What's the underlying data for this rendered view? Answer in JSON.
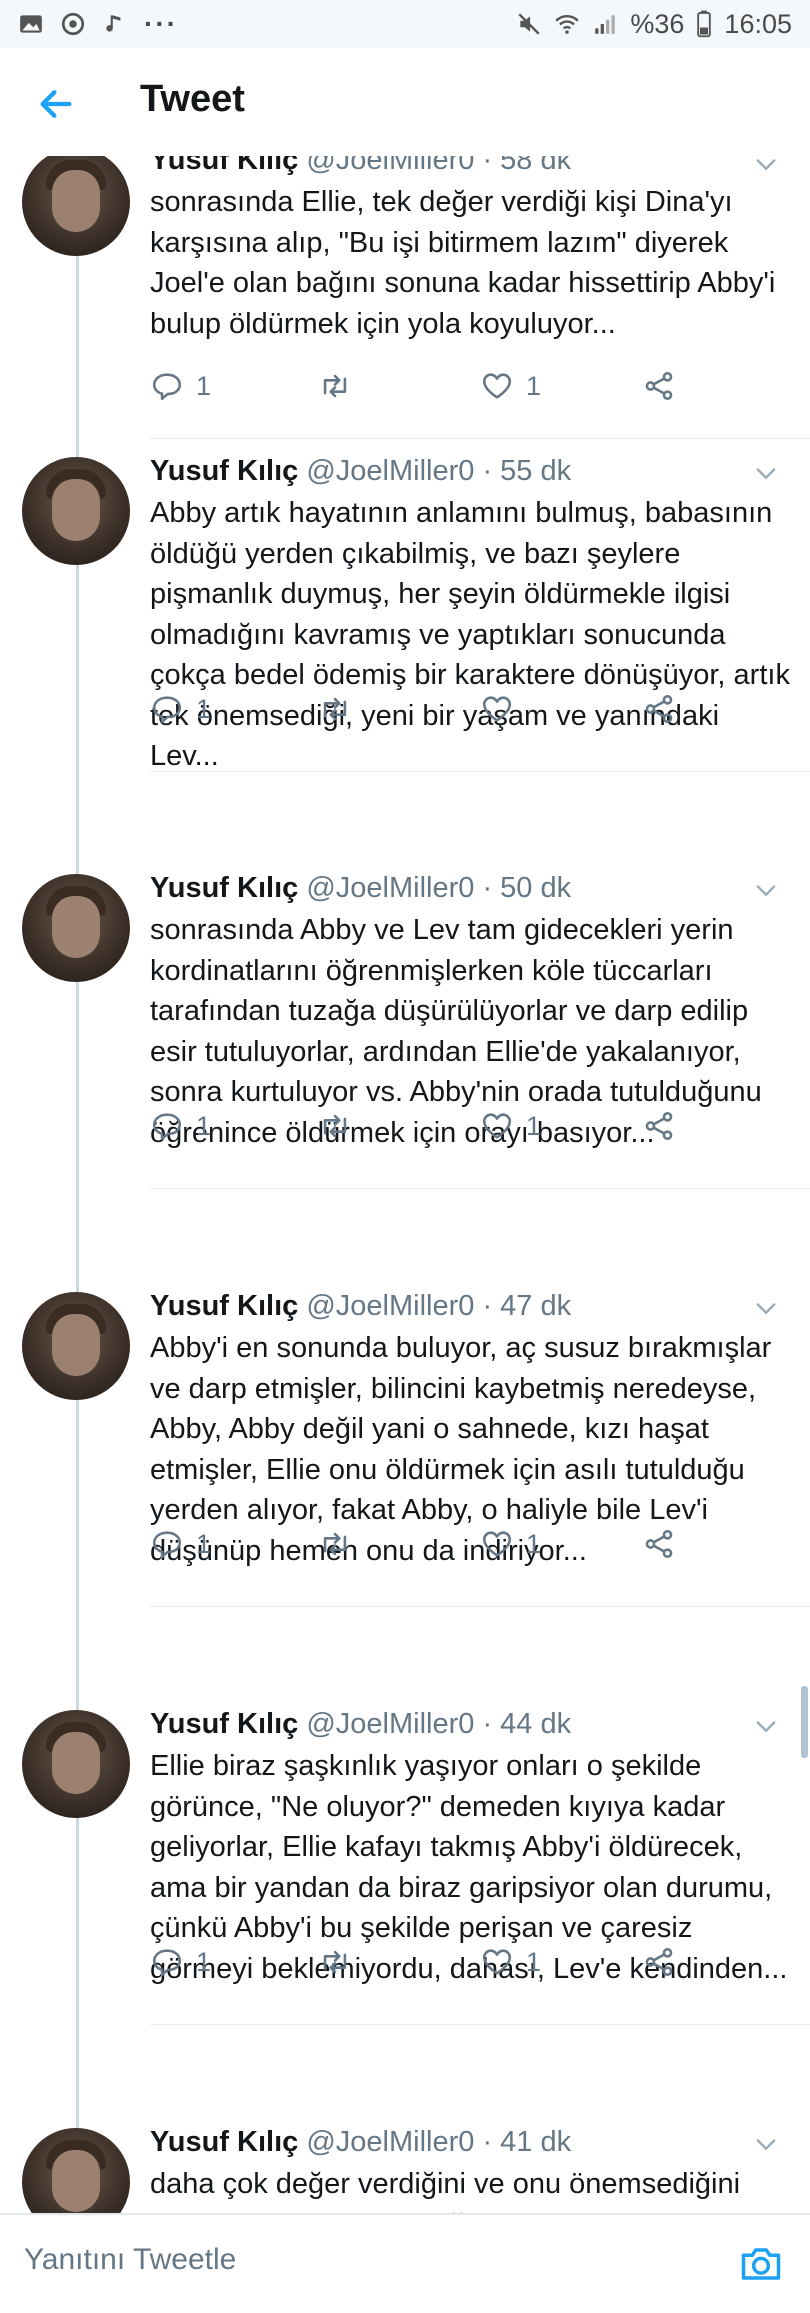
{
  "status_bar": {
    "battery": "%36",
    "time": "16:05",
    "dots": "···"
  },
  "header": {
    "title": "Tweet"
  },
  "colors": {
    "accent": "#1da1f2",
    "text": "#14171a",
    "secondary": "#657786",
    "divider": "#e6ecf0"
  },
  "tweets": [
    {
      "name": "Yusuf Kılıç",
      "handle": "@JoelMiller0",
      "time": "· 58 dk",
      "text": "sonrasında Ellie, tek değer verdiği kişi Dina'yı karşısına alıp, \"Bu işi bitirmem lazım\" diyerek Joel'e olan bağını sonuna kadar hissettirip Abby'i bulup öldürmek için yola koyuluyor...",
      "replies": "1",
      "retweets": "",
      "likes": "1"
    },
    {
      "name": "Yusuf Kılıç",
      "handle": "@JoelMiller0",
      "time": "· 55 dk",
      "text": "Abby artık hayatının anlamını bulmuş, babasının öldüğü yerden çıkabilmiş, ve bazı şeylere pişmanlık duymuş, her şeyin öldürmekle ilgisi olmadığını kavramış ve yaptıkları sonucunda çokça bedel ödemiş bir karaktere dönüşüyor, artık tek önemsediği, yeni bir yaşam ve yanındaki Lev...",
      "replies": "1",
      "retweets": "",
      "likes": ""
    },
    {
      "name": "Yusuf Kılıç",
      "handle": "@JoelMiller0",
      "time": "· 50 dk",
      "text": "sonrasında Abby ve Lev tam gidecekleri yerin kordinatlarını öğrenmişlerken köle tüccarları tarafından tuzağa düşürülüyorlar ve darp edilip esir tutuluyorlar, ardından Ellie'de yakalanıyor, sonra kurtuluyor vs. Abby'nin orada tutulduğunu öğrenince öldürmek için orayı basıyor...",
      "replies": "1",
      "retweets": "",
      "likes": "1"
    },
    {
      "name": "Yusuf Kılıç",
      "handle": "@JoelMiller0",
      "time": "· 47 dk",
      "text": "Abby'i en sonunda buluyor, aç susuz bırakmışlar ve darp etmişler, bilincini kaybetmiş neredeyse, Abby, Abby değil yani o sahnede, kızı haşat etmişler, Ellie onu öldürmek için asılı tutulduğu yerden alıyor, fakat Abby, o haliyle bile Lev'i düşünüp hemen onu da indiriyor...",
      "replies": "1",
      "retweets": "",
      "likes": "1"
    },
    {
      "name": "Yusuf Kılıç",
      "handle": "@JoelMiller0",
      "time": "· 44 dk",
      "text": "Ellie biraz şaşkınlık yaşıyor onları o şekilde görünce, \"Ne oluyor?\" demeden kıyıya kadar geliyorlar, Ellie kafayı takmış Abby'i öldürecek, ama bir yandan da biraz garipsiyor olan durumu, çünkü Abby'i bu şekilde perişan ve çaresiz görmeyi beklemiyordu, dahası, Lev'e kendinden...",
      "replies": "1",
      "retweets": "",
      "likes": "1"
    },
    {
      "name": "Yusuf Kılıç",
      "handle": "@JoelMiller0",
      "time": "· 41 dk",
      "text": "daha çok değer verdiğini ve onu önemsediğini görüyor, tüm bunlara rağmen Ellie Abby'e",
      "replies": "",
      "retweets": "",
      "likes": ""
    }
  ],
  "reply_bar": {
    "placeholder": "Yanıtını Tweetle"
  }
}
